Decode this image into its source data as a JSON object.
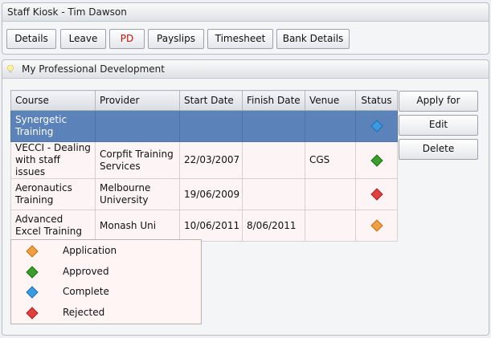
{
  "window": {
    "title": "Staff Kiosk - Tim Dawson"
  },
  "toolbar": {
    "buttons": [
      {
        "label": "Details"
      },
      {
        "label": "Leave"
      },
      {
        "label": "PD"
      },
      {
        "label": "Payslips"
      },
      {
        "label": "Timesheet"
      },
      {
        "label": "Bank Details"
      }
    ]
  },
  "pd_panel": {
    "title": "My Professional Development",
    "columns": [
      "Course",
      "Provider",
      "Start Date",
      "Finish Date",
      "Venue",
      "Status"
    ],
    "rows": [
      {
        "course": "Synergetic Training",
        "provider": "",
        "start": "",
        "finish": "",
        "venue": "",
        "status": "complete"
      },
      {
        "course": "VECCI - Dealing with staff issues",
        "provider": "Corpfit Training Services",
        "start": "22/03/2007",
        "finish": "",
        "venue": "CGS",
        "status": "approved"
      },
      {
        "course": "Aeronautics Training",
        "provider": "Melbourne University",
        "start": "19/06/2009",
        "finish": "",
        "venue": "",
        "status": "rejected"
      },
      {
        "course": "Advanced Excel Training",
        "provider": "Monash Uni",
        "start": "10/06/2011",
        "finish": "8/06/2011",
        "venue": "",
        "status": "application"
      }
    ],
    "actions": {
      "apply": "Apply for",
      "edit": "Edit",
      "delete": "Delete"
    },
    "legend": [
      {
        "label": "Application",
        "icon": "application-diamond-icon",
        "color": "#f0a040"
      },
      {
        "label": "Approved",
        "icon": "approved-diamond-icon",
        "color": "#3aa02a"
      },
      {
        "label": "Complete",
        "icon": "complete-diamond-icon",
        "color": "#3a9be0"
      },
      {
        "label": "Rejected",
        "icon": "rejected-diamond-icon",
        "color": "#e04040"
      }
    ]
  },
  "colors": {
    "selected_row": "#5b82b9",
    "active_tab_text": "#cc1010"
  }
}
